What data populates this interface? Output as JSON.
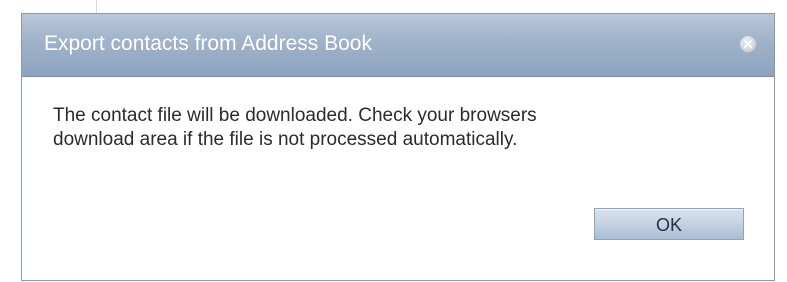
{
  "dialog": {
    "title": "Export contacts from Address Book",
    "message_lines": [
      "The contact file will be downloaded. Check your browsers",
      "download area if the file is not processed automatically."
    ],
    "buttons": {
      "ok_label": "OK"
    },
    "icons": {
      "close": "close-icon"
    }
  }
}
